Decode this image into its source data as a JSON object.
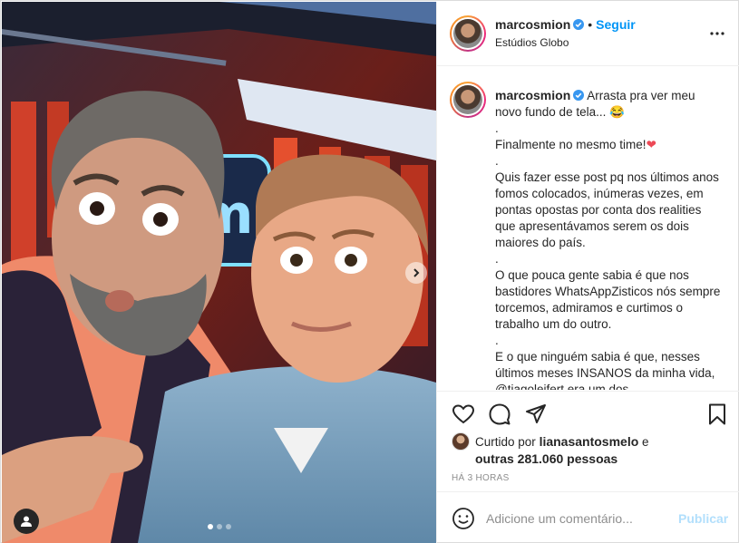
{
  "header": {
    "username": "marcosmion",
    "bullet": "•",
    "follow_label": "Seguir",
    "location": "Estúdios Globo",
    "more_icon": "more-horizontal-icon"
  },
  "caption": {
    "username": "marcosmion",
    "lines": [
      "Arrasta pra ver meu novo fundo de tela... 😂",
      ".",
      "Finalmente no mesmo time!",
      ".",
      "Quis fazer esse post pq nos últimos anos fomos colocados, inúmeras vezes, em pontas opostas por conta dos realities que apresentávamos serem os dois maiores do país.",
      ".",
      "O que pouca gente sabia é que nos bastidores WhatsAppZisticos nós sempre torcemos, admiramos e curtimos o trabalho um do outro.",
      ".",
      "E o que ninguém sabia é que, nesses últimos meses INSANOS da minha vida, @tiagoleifert era um dos"
    ],
    "heart": "❤"
  },
  "likes": {
    "prefix": "Curtido por",
    "user": "lianasantosmelo",
    "conj": "e",
    "others": "outras 281.060 pessoas"
  },
  "timestamp": "HÁ 3 HORAS",
  "comment": {
    "placeholder": "Adicione um comentário...",
    "publish_label": "Publicar"
  },
  "carousel": {
    "total": 3,
    "active": 1
  },
  "colors": {
    "accent": "#0095f6",
    "verified": "#3897f0",
    "border": "#dbdbdb",
    "muted": "#8e8e8e",
    "publish_disabled": "#b2dffc"
  }
}
